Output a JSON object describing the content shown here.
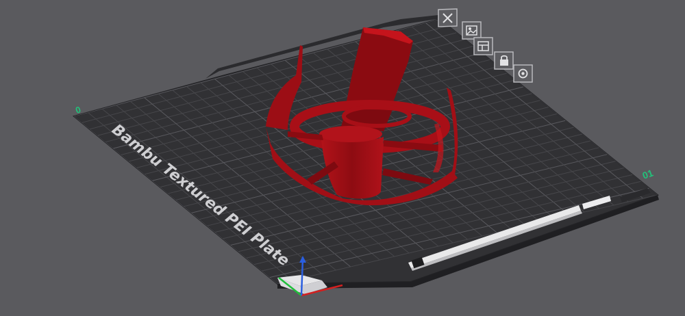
{
  "viewport": {
    "plate_name": "Bambu Textured PEI Plate",
    "axis_marker_left": "0",
    "axis_marker_right": "01",
    "plate_index": "01",
    "colors": {
      "background": "#5a5a5e",
      "bed": "#313134",
      "grid": "#4c4c50",
      "model": "#a10f16",
      "x_axis": "#d42020",
      "y_axis": "#1fbf3a",
      "z_axis": "#2a5ee0",
      "marker": "#22c27a"
    }
  },
  "plate_toolbar": {
    "buttons": [
      {
        "name": "delete-plate-button",
        "icon": "close-icon"
      },
      {
        "name": "pick-plate-button",
        "icon": "image-icon"
      },
      {
        "name": "arrange-plate-button",
        "icon": "arrange-icon"
      },
      {
        "name": "lock-plate-button",
        "icon": "lock-icon"
      },
      {
        "name": "plate-settings-button",
        "icon": "eye-gear-icon"
      }
    ]
  }
}
